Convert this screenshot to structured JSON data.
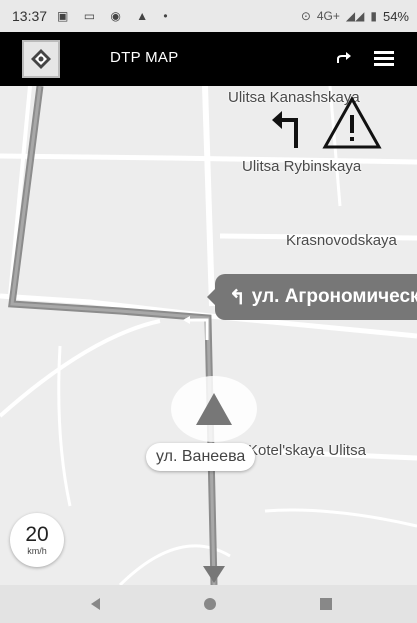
{
  "status_bar": {
    "time": "13:37",
    "left_icons": "▣ ▭ ◉ ▲ •",
    "network": "4G+",
    "battery": "54%"
  },
  "app_bar": {
    "title": "DTP MAP",
    "logo_icon": "app-logo-icon",
    "share_icon": "share-arrow-icon",
    "menu_icon": "hamburger-menu-icon"
  },
  "map": {
    "streets": {
      "kanashskaya": "Ulitsa Kanashskaya",
      "rybinskaya": "Ulitsa Rybinskaya",
      "krasnovodskaya": "Krasnovodskaya",
      "kotelskaya": "Kotel'skaya Ulitsa"
    },
    "route_color": "#8c8c8c",
    "alert_icons": [
      "turn-left-icon",
      "warning-triangle-icon"
    ]
  },
  "navigation": {
    "next_turn_street": "ул. Агрономическая",
    "current_street": "ул. Ванеева"
  },
  "speed": {
    "value": "20",
    "unit": "km/h"
  },
  "system_nav": {
    "back": "back-icon",
    "home": "home-icon",
    "recents": "recents-icon"
  }
}
